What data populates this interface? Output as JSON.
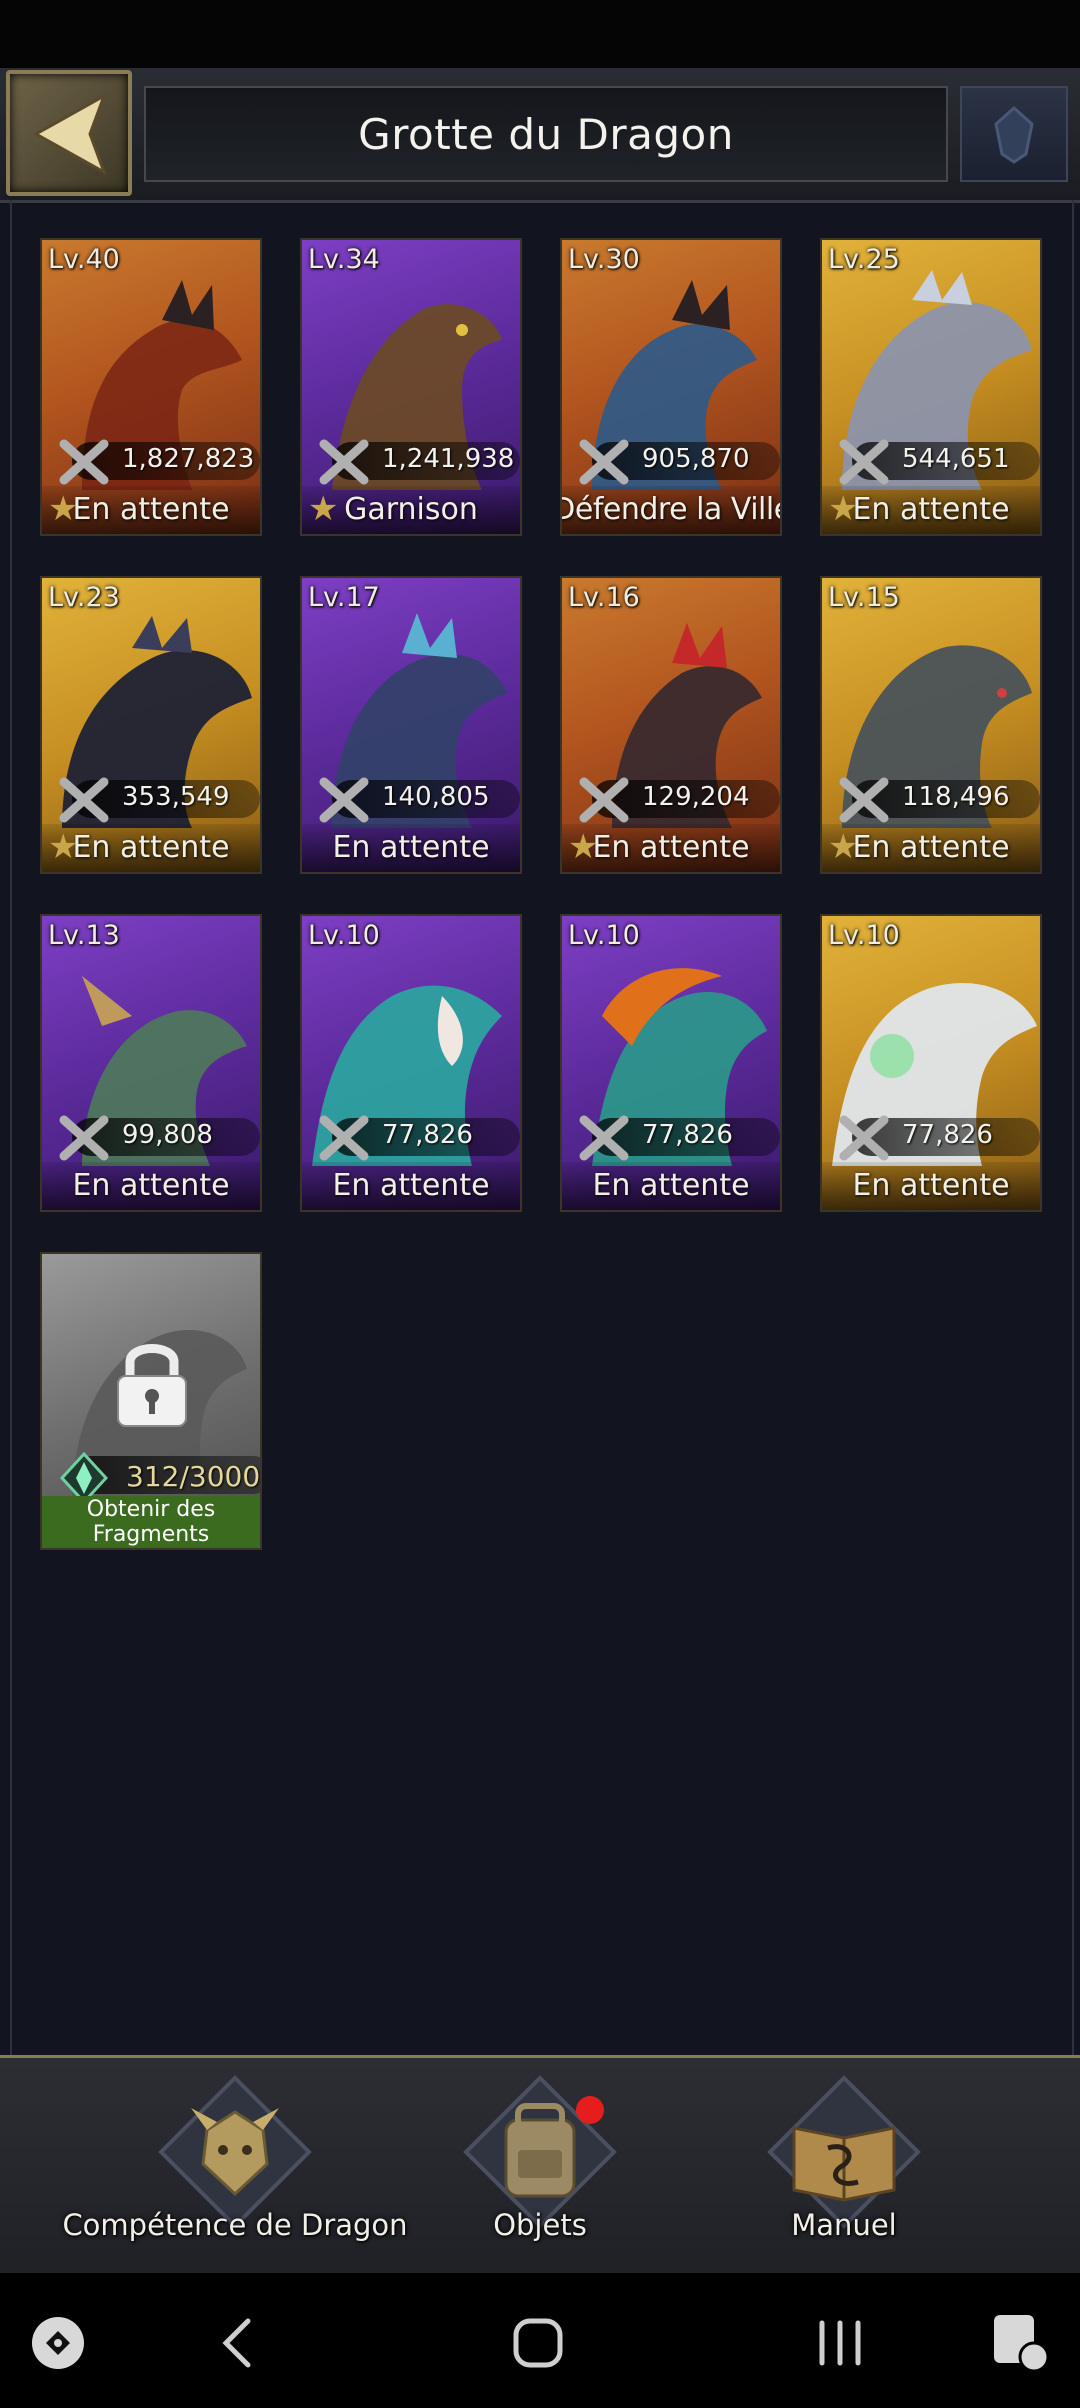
{
  "header": {
    "title": "Grotte du Dragon"
  },
  "dragons": [
    {
      "level": "Lv.40",
      "power": "1,827,823",
      "status": "En attente",
      "color": "orange",
      "starred": true
    },
    {
      "level": "Lv.34",
      "power": "1,241,938",
      "status": "Garnison",
      "color": "purple",
      "starred": true
    },
    {
      "level": "Lv.30",
      "power": "905,870",
      "status": "Défendre la Ville",
      "color": "orange",
      "starred": false
    },
    {
      "level": "Lv.25",
      "power": "544,651",
      "status": "En attente",
      "color": "gold",
      "starred": true
    },
    {
      "level": "Lv.23",
      "power": "353,549",
      "status": "En attente",
      "color": "gold",
      "starred": true
    },
    {
      "level": "Lv.17",
      "power": "140,805",
      "status": "En attente",
      "color": "purple",
      "starred": false
    },
    {
      "level": "Lv.16",
      "power": "129,204",
      "status": "En attente",
      "color": "orange",
      "starred": true
    },
    {
      "level": "Lv.15",
      "power": "118,496",
      "status": "En attente",
      "color": "gold",
      "starred": true
    },
    {
      "level": "Lv.13",
      "power": "99,808",
      "status": "En attente",
      "color": "purple",
      "starred": false
    },
    {
      "level": "Lv.10",
      "power": "77,826",
      "status": "En attente",
      "color": "purple",
      "starred": false
    },
    {
      "level": "Lv.10",
      "power": "77,826",
      "status": "En attente",
      "color": "purple",
      "starred": false
    },
    {
      "level": "Lv.10",
      "power": "77,826",
      "status": "En attente",
      "color": "gold",
      "starred": false
    }
  ],
  "locked_dragon": {
    "fragments": "312/3000",
    "button_line1": "Obtenir des",
    "button_line2": "Fragments"
  },
  "bottom_menu": [
    {
      "label": "Compétence de Dragon",
      "icon": "dragon-skill-icon"
    },
    {
      "label": "Objets",
      "icon": "backpack-icon",
      "badge": true
    },
    {
      "label": "Manuel",
      "icon": "manual-book-icon"
    }
  ],
  "colors": {
    "orange": "#b2551f",
    "purple": "#5b2a9a",
    "gold": "#c68f22",
    "badge": "#e51d1d",
    "fragment_button": "#3b6b1f"
  }
}
